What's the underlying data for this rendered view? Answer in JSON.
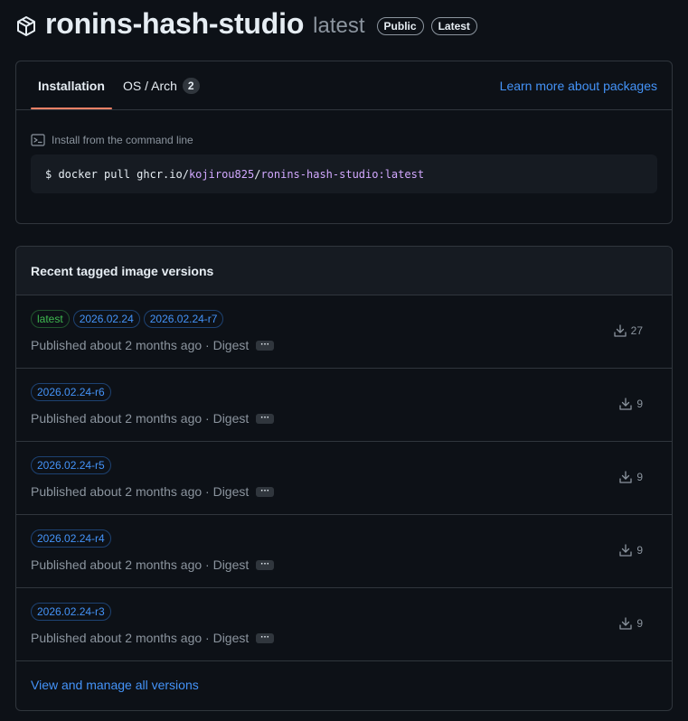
{
  "package": {
    "name": "ronins-hash-studio",
    "version": "latest",
    "badges": [
      "Public",
      "Latest"
    ]
  },
  "tabs": {
    "installation": "Installation",
    "os_arch": "OS / Arch",
    "os_arch_count": "2",
    "learn_more": "Learn more about packages"
  },
  "install": {
    "label": "Install from the command line",
    "cmd_prefix": "$ docker pull ghcr.io/",
    "cmd_user": "kojirou825",
    "cmd_sep": "/",
    "cmd_image": "ronins-hash-studio:latest"
  },
  "versions": {
    "title": "Recent tagged image versions",
    "meta_text": "Published about 2 months ago · Digest",
    "rows": [
      {
        "tags": [
          "latest",
          "2026.02.24",
          "2026.02.24-r7"
        ],
        "downloads": "27"
      },
      {
        "tags": [
          "2026.02.24-r6"
        ],
        "downloads": "9"
      },
      {
        "tags": [
          "2026.02.24-r5"
        ],
        "downloads": "9"
      },
      {
        "tags": [
          "2026.02.24-r4"
        ],
        "downloads": "9"
      },
      {
        "tags": [
          "2026.02.24-r3"
        ],
        "downloads": "9"
      }
    ],
    "footer_link": "View and manage all versions"
  },
  "colors": {
    "background": "#0d1117",
    "accent_link": "#4493f8",
    "tab_underline": "#f78166",
    "tag_green": "#3fb950",
    "code_accent": "#d2a8ff"
  },
  "icons": {
    "package": "package-icon",
    "terminal": "terminal-icon",
    "download": "download-icon"
  }
}
